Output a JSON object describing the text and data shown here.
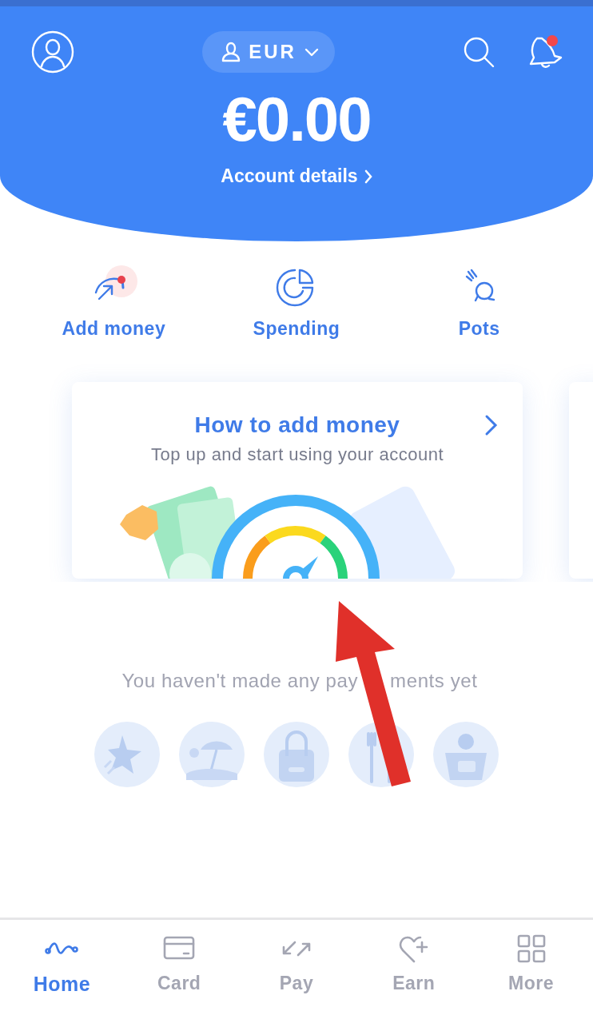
{
  "header": {
    "currency": "EUR",
    "balance": "€0.00",
    "account_link": "Account details",
    "has_notification": true
  },
  "quick_actions": [
    {
      "kind": "add",
      "label": "Add money"
    },
    {
      "kind": "spending",
      "label": "Spending"
    },
    {
      "kind": "pots",
      "label": "Pots"
    }
  ],
  "promo_card": {
    "title": "How to add money",
    "subtitle": "Top up and start using your account"
  },
  "empty_state": {
    "message_parts": [
      "You haven't made any pay",
      "ments yet"
    ]
  },
  "tab_bar": [
    {
      "kind": "home",
      "label": "Home",
      "selected": true
    },
    {
      "kind": "card",
      "label": "Card",
      "selected": false
    },
    {
      "kind": "pay",
      "label": "Pay",
      "selected": false
    },
    {
      "kind": "earn",
      "label": "Earn",
      "selected": false
    },
    {
      "kind": "more",
      "label": "More",
      "selected": false
    }
  ]
}
